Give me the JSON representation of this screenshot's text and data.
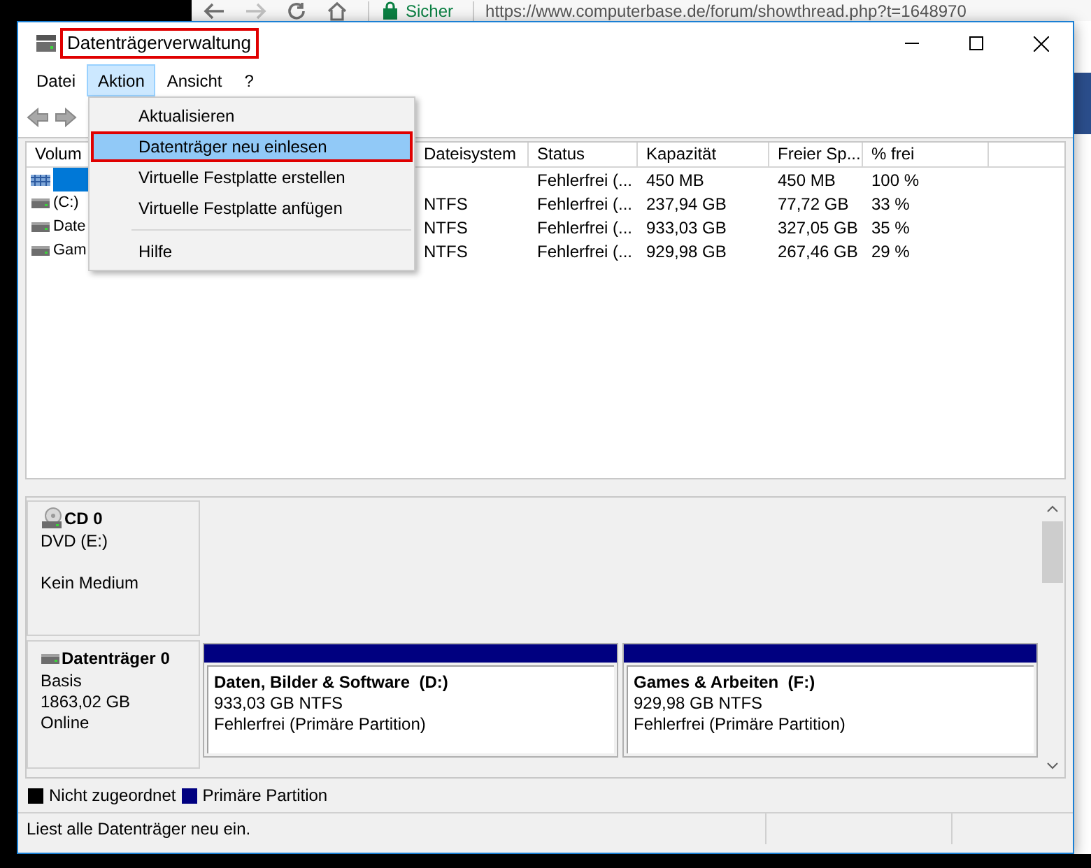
{
  "browser": {
    "security": "Sicher",
    "url": "https://www.computerbase.de/forum/showthread.php?t=1648970"
  },
  "window": {
    "title": "Datenträgerverwaltung",
    "title_annotated": true
  },
  "menu_bar": [
    {
      "label": "Datei",
      "selected": false
    },
    {
      "label": "Aktion",
      "selected": true
    },
    {
      "label": "Ansicht",
      "selected": false
    },
    {
      "label": "?",
      "selected": false
    }
  ],
  "dropdown": [
    {
      "kind": "item",
      "label": "Aktualisieren",
      "selected": false,
      "annotated": false
    },
    {
      "kind": "item",
      "label": "Datenträger neu einlesen",
      "selected": true,
      "annotated": true
    },
    {
      "kind": "item",
      "label": "Virtuelle Festplatte erstellen",
      "selected": false,
      "annotated": false
    },
    {
      "kind": "item",
      "label": "Virtuelle Festplatte anfügen",
      "selected": false,
      "annotated": false
    },
    {
      "kind": "separator"
    },
    {
      "kind": "item",
      "label": "Hilfe",
      "selected": false,
      "annotated": false
    }
  ],
  "table": {
    "columns": [
      "Volum",
      "Dateisystem",
      "Status",
      "Kapazität",
      "Freier Sp...",
      "% frei"
    ],
    "rows": [
      {
        "kind": "reserved",
        "selected": true,
        "cells": [
          null,
          null,
          "Fehlerfrei (...",
          "450 MB",
          "450 MB",
          "100 %"
        ]
      },
      {
        "kind": "drive",
        "selected": false,
        "cells": [
          "(C:)",
          "NTFS",
          "Fehlerfrei (...",
          "237,94 GB",
          "77,72 GB",
          "33 %"
        ]
      },
      {
        "kind": "drive",
        "selected": false,
        "cells": [
          "Date",
          "NTFS",
          "Fehlerfrei (...",
          "933,03 GB",
          "327,05 GB",
          "35 %"
        ]
      },
      {
        "kind": "drive",
        "selected": false,
        "cells": [
          "Gam",
          "NTFS",
          "Fehlerfrei (...",
          "929,98 GB",
          "267,46 GB",
          "29 %"
        ]
      }
    ]
  },
  "disks": [
    {
      "kind": "cd",
      "name": "CD 0",
      "lines": [
        "DVD (E:)",
        "Kein Medium"
      ]
    },
    {
      "kind": "disk",
      "name": "Datenträger 0",
      "lines": [
        "Basis",
        "1863,02 GB",
        "Online"
      ],
      "partitions": [
        {
          "name": "Daten, Bilder & Software  (D:)",
          "size": "933,03 GB NTFS",
          "status": "Fehlerfrei (Primäre Partition)"
        },
        {
          "name": "Games & Arbeiten  (F:)",
          "size": "929,98 GB NTFS",
          "status": "Fehlerfrei (Primäre Partition)"
        }
      ]
    }
  ],
  "legend": [
    {
      "label": "Nicht zugeordnet",
      "color": "#000000"
    },
    {
      "label": "Primäre Partition",
      "color": "#000080"
    }
  ],
  "status_bar": "Liest alle Datenträger neu ein."
}
